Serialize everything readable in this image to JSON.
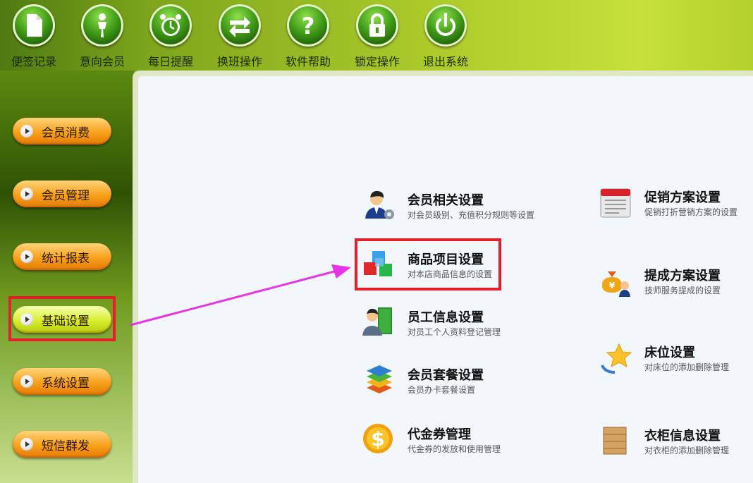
{
  "toolbar": {
    "items": [
      {
        "label": "便签记录",
        "icon": "note-icon"
      },
      {
        "label": "意向会员",
        "icon": "person-icon"
      },
      {
        "label": "每日提醒",
        "icon": "alarm-clock-icon"
      },
      {
        "label": "换班操作",
        "icon": "swap-arrows-icon"
      },
      {
        "label": "软件帮助",
        "icon": "question-icon"
      },
      {
        "label": "锁定操作",
        "icon": "lock-icon"
      },
      {
        "label": "退出系统",
        "icon": "power-icon"
      }
    ]
  },
  "sidebar": {
    "items": [
      {
        "label": "会员消费"
      },
      {
        "label": "会员管理"
      },
      {
        "label": "统计报表"
      },
      {
        "label": "基础设置",
        "active": true
      },
      {
        "label": "系统设置"
      },
      {
        "label": "短信群发"
      }
    ]
  },
  "settings": {
    "left": [
      {
        "title": "会员相关设置",
        "desc": "对会员级别、充值积分规则等设置",
        "icon": "member-settings-icon"
      },
      {
        "title": "商品项目设置",
        "desc": "对本店商品信息的设置",
        "icon": "cubes-icon",
        "highlighted": true
      },
      {
        "title": "员工信息设置",
        "desc": "对员工个人资料登记管理",
        "icon": "staff-book-icon"
      },
      {
        "title": "会员套餐设置",
        "desc": "会员办卡套餐设置",
        "icon": "layers-icon"
      },
      {
        "title": "代金券管理",
        "desc": "代金券的发放和使用管理",
        "icon": "dollar-coin-icon"
      }
    ],
    "right": [
      {
        "title": "促销方案设置",
        "desc": "促销打折营销方案的设置",
        "icon": "calendar-icon"
      },
      {
        "title": "提成方案设置",
        "desc": "技师服务提成的设置",
        "icon": "money-bag-icon"
      },
      {
        "title": "床位设置",
        "desc": "对床位的添加删除管理",
        "icon": "star-icon"
      },
      {
        "title": "衣柜信息设置",
        "desc": "对衣柜的添加删除管理",
        "icon": "cabinet-icon"
      }
    ]
  },
  "colors": {
    "highlight": "#e41e2a",
    "arrow": "#e633e6"
  }
}
